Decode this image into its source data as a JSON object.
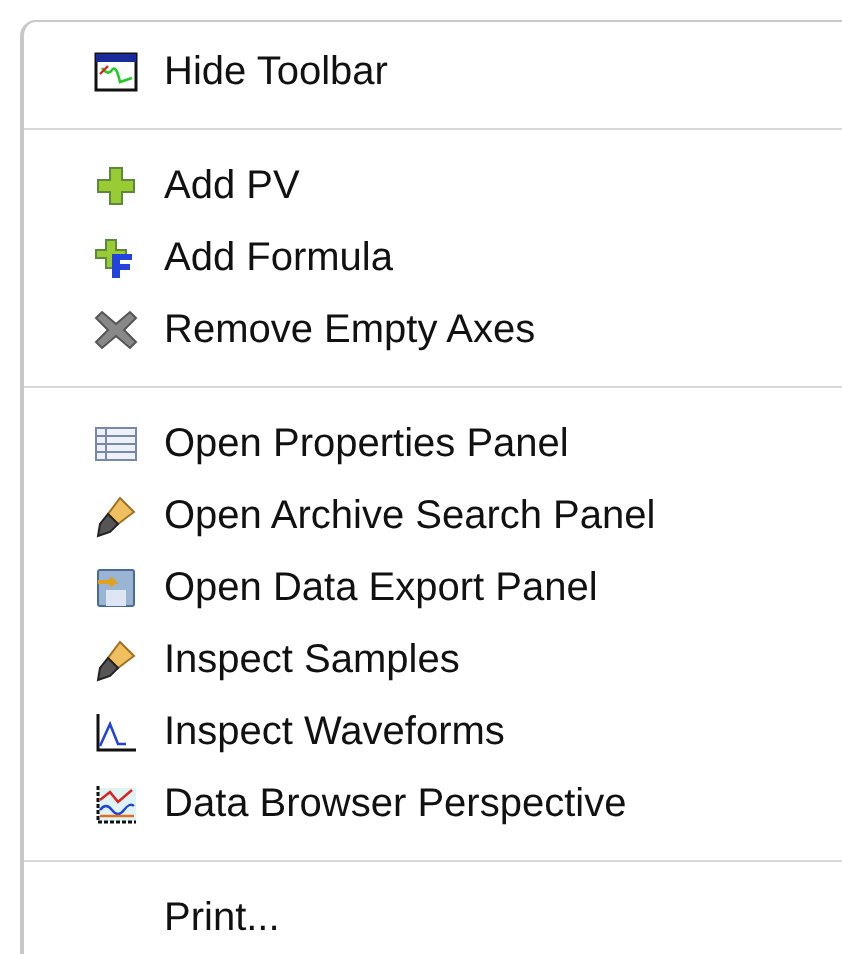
{
  "menu": {
    "groups": [
      {
        "items": [
          {
            "label": "Hide Toolbar",
            "kind": "toolbar"
          }
        ]
      },
      {
        "items": [
          {
            "label": "Add PV",
            "kind": "plus"
          },
          {
            "label": "Add Formula",
            "kind": "formula"
          },
          {
            "label": "Remove Empty Axes",
            "kind": "remove"
          }
        ]
      },
      {
        "items": [
          {
            "label": "Open Properties Panel",
            "kind": "table"
          },
          {
            "label": "Open Archive Search Panel",
            "kind": "pen"
          },
          {
            "label": "Open Data Export Panel",
            "kind": "disk"
          },
          {
            "label": "Inspect Samples",
            "kind": "pen"
          },
          {
            "label": "Inspect Waveforms",
            "kind": "wave"
          },
          {
            "label": "Data Browser Perspective",
            "kind": "chart"
          }
        ]
      },
      {
        "items": [
          {
            "label": "Print...",
            "kind": "plain"
          }
        ]
      }
    ]
  }
}
